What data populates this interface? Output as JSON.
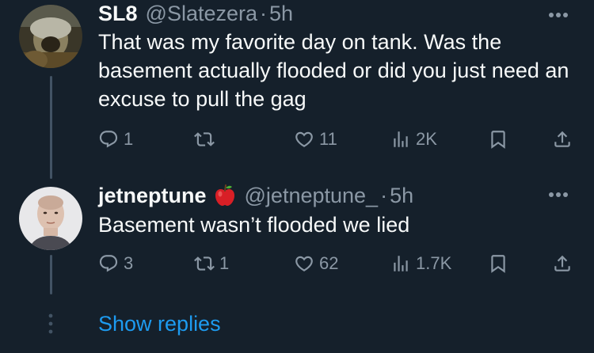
{
  "tweets": [
    {
      "display_name": "SL8",
      "handle": "@Slatezera",
      "separator": "·",
      "time": "5h",
      "text": "That was my favorite day on tank. Was the basement actually flooded or did you just need an excuse to pull the gag",
      "actions": {
        "replies": "1",
        "retweets": "",
        "likes": "11",
        "views": "2K"
      },
      "icons": {
        "more": "more-horizontal-icon",
        "reply": "reply-icon",
        "retweet": "retweet-icon",
        "like": "heart-icon",
        "views": "views-icon",
        "bookmark": "bookmark-icon",
        "share": "share-icon"
      }
    },
    {
      "display_name": "jetneptune",
      "badge": "apple-emoji-icon",
      "handle": "@jetneptune_",
      "separator": "·",
      "time": "5h",
      "text": "Basement wasn’t flooded we lied",
      "actions": {
        "replies": "3",
        "retweets": "1",
        "likes": "62",
        "views": "1.7K"
      },
      "icons": {
        "more": "more-horizontal-icon",
        "reply": "reply-icon",
        "retweet": "retweet-icon",
        "like": "heart-icon",
        "views": "views-icon",
        "bookmark": "bookmark-icon",
        "share": "share-icon"
      }
    }
  ],
  "show_replies": "Show replies",
  "colors": {
    "background": "#15202b",
    "text_primary": "#f7f9f9",
    "text_secondary": "#8b98a5",
    "link": "#1d9bf0",
    "thread_line": "#425364"
  }
}
